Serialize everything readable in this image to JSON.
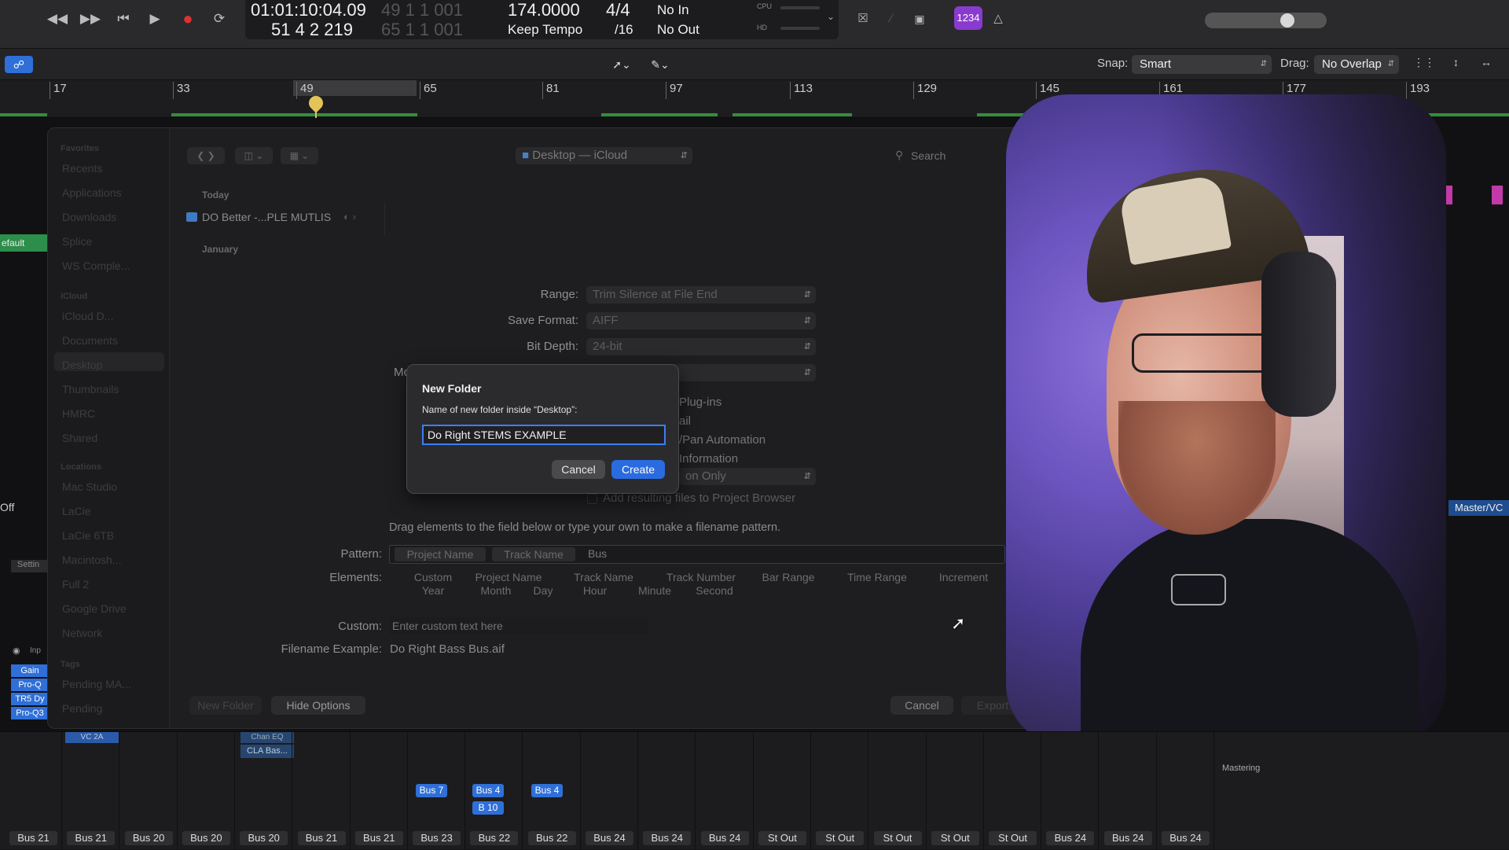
{
  "toolbar": {
    "lcd": {
      "time": "01:01:10:04.09",
      "time_sub": "49  1  1  001",
      "position": "51  4  2  219",
      "position_sub": "65  1  1  001",
      "tempo": "174.0000",
      "tempo_mode": "Keep Tempo",
      "signature": "4/4",
      "division": "/16",
      "in": "No In",
      "out": "No Out",
      "cpu_label": "CPU",
      "hd_label": "HD"
    },
    "count_badge": "1234"
  },
  "secondbar": {
    "snap_label": "Snap:",
    "snap_value": "Smart",
    "drag_label": "Drag:",
    "drag_value": "No Overlap"
  },
  "ruler": {
    "bars": [
      "17",
      "33",
      "49",
      "65",
      "81",
      "97",
      "113",
      "129",
      "145",
      "161",
      "177",
      "193"
    ]
  },
  "left_strip": {
    "default_label": "efault",
    "off_label": "Off",
    "settings_label": "Settin",
    "inp_label": "Inp",
    "plugins": [
      "Gain",
      "Pro-Q",
      "TR5 Dy",
      "Pro-Q3"
    ]
  },
  "right_strip": {
    "master_label": "Master/VC"
  },
  "dialog": {
    "location": "Desktop — iCloud",
    "search_placeholder": "Search",
    "today": "Today",
    "file_item": "DO Better -...PLE MUTLIS",
    "january": "January",
    "sidebar": {
      "favorites": "Favorites",
      "fav_items": [
        "Recents",
        "Applications",
        "Downloads",
        "Splice",
        "WS Comple..."
      ],
      "icloud": "iCloud",
      "icloud_items": [
        "iCloud D...",
        "Documents",
        "Desktop",
        "Thumbnails",
        "HMRC",
        "Shared"
      ],
      "locations": "Locations",
      "location_items": [
        "Mac Studio",
        "LaCie",
        "LaCie 6TB",
        "Macintosh...",
        "Full 2",
        "Google Drive",
        "Network"
      ],
      "tags": "Tags",
      "tag_items": [
        "Pending MA...",
        "Pending"
      ]
    },
    "range_label": "Range:",
    "range_value": "Trim Silence at File End",
    "format_label": "Save Format:",
    "format_value": "AIFF",
    "depth_label": "Bit Depth:",
    "depth_value": "24-bit",
    "hidden_label": "Mo",
    "opt_plugins": "Plug-ins",
    "opt_tail": "ail",
    "opt_automation": "/Pan Automation",
    "opt_info": "Information",
    "opt_only": "on Only",
    "add_to_browser": "Add resulting files to Project Browser",
    "drag_hint": "Drag elements to the field below or type your own to make a filename pattern.",
    "pattern_label": "Pattern:",
    "pattern_tokens": [
      "Project Name",
      "Track Name",
      "Bus"
    ],
    "elements_label": "Elements:",
    "elements_row1": [
      "Custom",
      "Project Name",
      "Track Name",
      "Track Number",
      "Bar Range",
      "Time Range",
      "Increment"
    ],
    "elements_row2": [
      "Year",
      "Month",
      "Day",
      "Hour",
      "Minute",
      "Second"
    ],
    "custom_label": "Custom:",
    "custom_placeholder": "Enter custom text here",
    "example_label": "Filename Example:",
    "example_value": "Do Right Bass Bus.aif",
    "new_folder_button": "New Folder",
    "hide_options_button": "Hide Options",
    "cancel_button": "Cancel",
    "export_button": "Export"
  },
  "new_folder_sheet": {
    "title": "New Folder",
    "prompt": "Name of new folder inside “Desktop”:",
    "value": "Do Right STEMS EXAMPLE",
    "cancel": "Cancel",
    "create": "Create"
  },
  "mixer": {
    "inserts": [
      "Chan EQ",
      "CLA Bas..."
    ],
    "plugin_left": "VC 2A",
    "sends": [
      "Bus 7",
      "Bus 4",
      "Bus 4",
      "B 10"
    ],
    "mastering_label": "Mastering",
    "outputs": [
      "Bus 21",
      "Bus 21",
      "Bus 20",
      "Bus 20",
      "Bus 20",
      "Bus 21",
      "Bus 21",
      "Bus 23",
      "Bus 22",
      "Bus 22",
      "Bus 24",
      "Bus 24",
      "Bus 24",
      "St Out",
      "St Out",
      "St Out",
      "St Out",
      "St Out",
      "Bus 24",
      "Bus 24",
      "Bus 24"
    ]
  }
}
